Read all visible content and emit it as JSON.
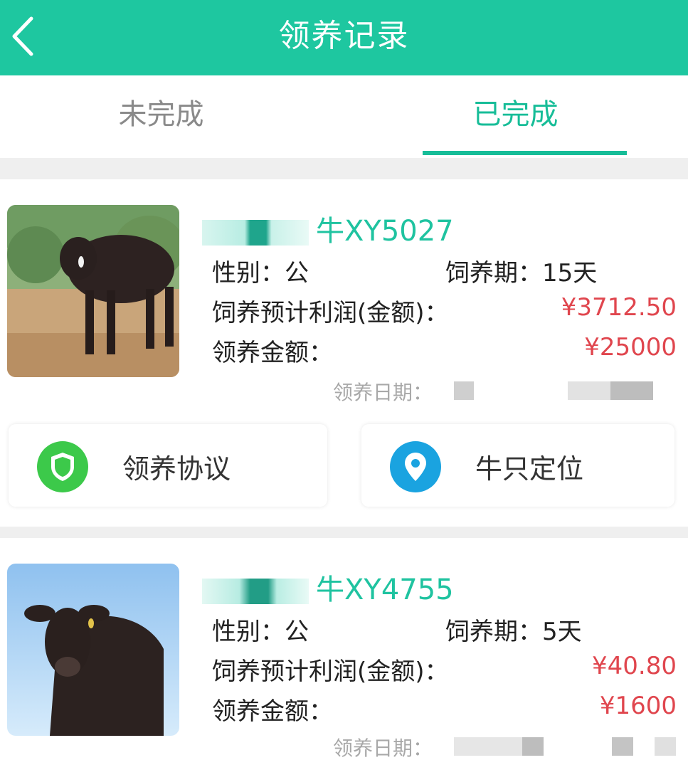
{
  "header": {
    "title": "领养记录"
  },
  "tabs": [
    {
      "label": "未完成"
    },
    {
      "label": "已完成"
    }
  ],
  "records": [
    {
      "name": "牛XY5027",
      "gender_label": "性别：",
      "gender": "公",
      "period_label": "饲养期：",
      "period": "15天",
      "profit_label": "饲养预计利润(金额)：",
      "profit": "¥3712.50",
      "amount_label": "领养金额：",
      "amount": "¥25000",
      "date_label": "领养日期：",
      "buttons": [
        {
          "label": "领养协议",
          "icon": "shield-icon"
        },
        {
          "label": "牛只定位",
          "icon": "location-pin-icon"
        }
      ]
    },
    {
      "name": "牛XY4755",
      "gender_label": "性别：",
      "gender": "公",
      "period_label": "饲养期：",
      "period": "5天",
      "profit_label": "饲养预计利润(金额)：",
      "profit": "¥40.80",
      "amount_label": "领养金额：",
      "amount": "¥1600",
      "date_label": "领养日期："
    }
  ],
  "colors": {
    "accent": "#1ec7a0",
    "tab_active": "#17bd98",
    "price": "#e0464e"
  }
}
